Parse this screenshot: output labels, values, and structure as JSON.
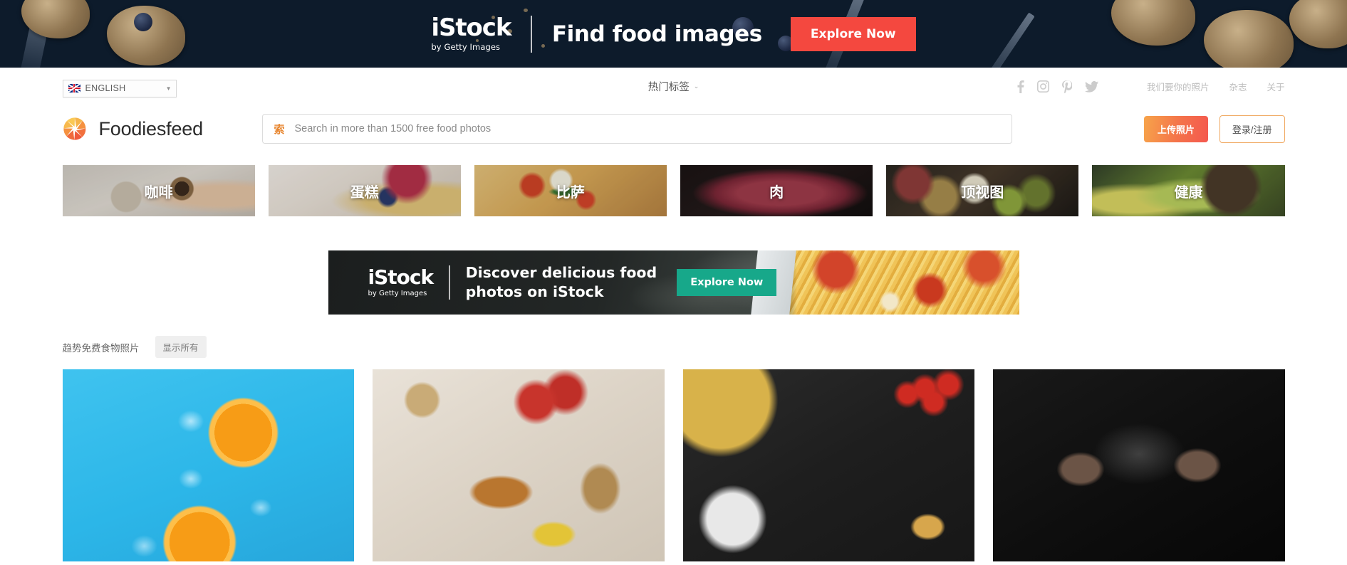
{
  "top_banner": {
    "logo_main": "iStock",
    "logo_sub": "by Getty Images",
    "headline": "Find food images",
    "cta_label": "Explore Now",
    "cta_color": "#f4483f"
  },
  "utility_nav": {
    "language": {
      "label": "ENGLISH",
      "flag": "uk-flag-icon",
      "caret": "chevron-down-icon"
    },
    "hot_tags": {
      "label": "热门标签",
      "caret": "chevron-down-icon"
    },
    "social": [
      {
        "name": "facebook-icon"
      },
      {
        "name": "instagram-icon"
      },
      {
        "name": "pinterest-icon"
      },
      {
        "name": "twitter-icon"
      }
    ],
    "links": [
      {
        "label": "我们要你的照片"
      },
      {
        "label": "杂志"
      },
      {
        "label": "关于"
      }
    ]
  },
  "brand": {
    "logo_icon": "aperture-icon",
    "name": "Foodiesfeed",
    "accent": "#f0853a"
  },
  "search": {
    "icon": "索",
    "value": "",
    "placeholder": "Search in more than 1500 free food photos"
  },
  "actions": {
    "upload_label": "上传照片",
    "login_label": "登录/注册"
  },
  "categories": [
    {
      "label": "咖啡",
      "art": "art-coffee"
    },
    {
      "label": "蛋糕",
      "art": "art-cake"
    },
    {
      "label": "比萨",
      "art": "art-pizza"
    },
    {
      "label": "肉",
      "art": "art-meat"
    },
    {
      "label": "顶视图",
      "art": "art-topview"
    },
    {
      "label": "健康",
      "art": "art-healthy"
    }
  ],
  "inline_ad": {
    "logo_main": "iStock",
    "logo_sub": "by Getty Images",
    "headline_line1": "Discover delicious food",
    "headline_line2": "photos on iStock",
    "cta_label": "Explore Now",
    "cta_color": "#17a88a"
  },
  "trending": {
    "title": "趋势免费食物照片",
    "show_all_label": "显示所有",
    "photos": [
      {
        "alt": "oranges-on-blue",
        "art": "g-orange"
      },
      {
        "alt": "burger-flatlay",
        "art": "g-burger"
      },
      {
        "alt": "pizza-on-slate",
        "art": "g-pizza"
      },
      {
        "alt": "hands-with-flour",
        "art": "g-flour"
      }
    ]
  }
}
